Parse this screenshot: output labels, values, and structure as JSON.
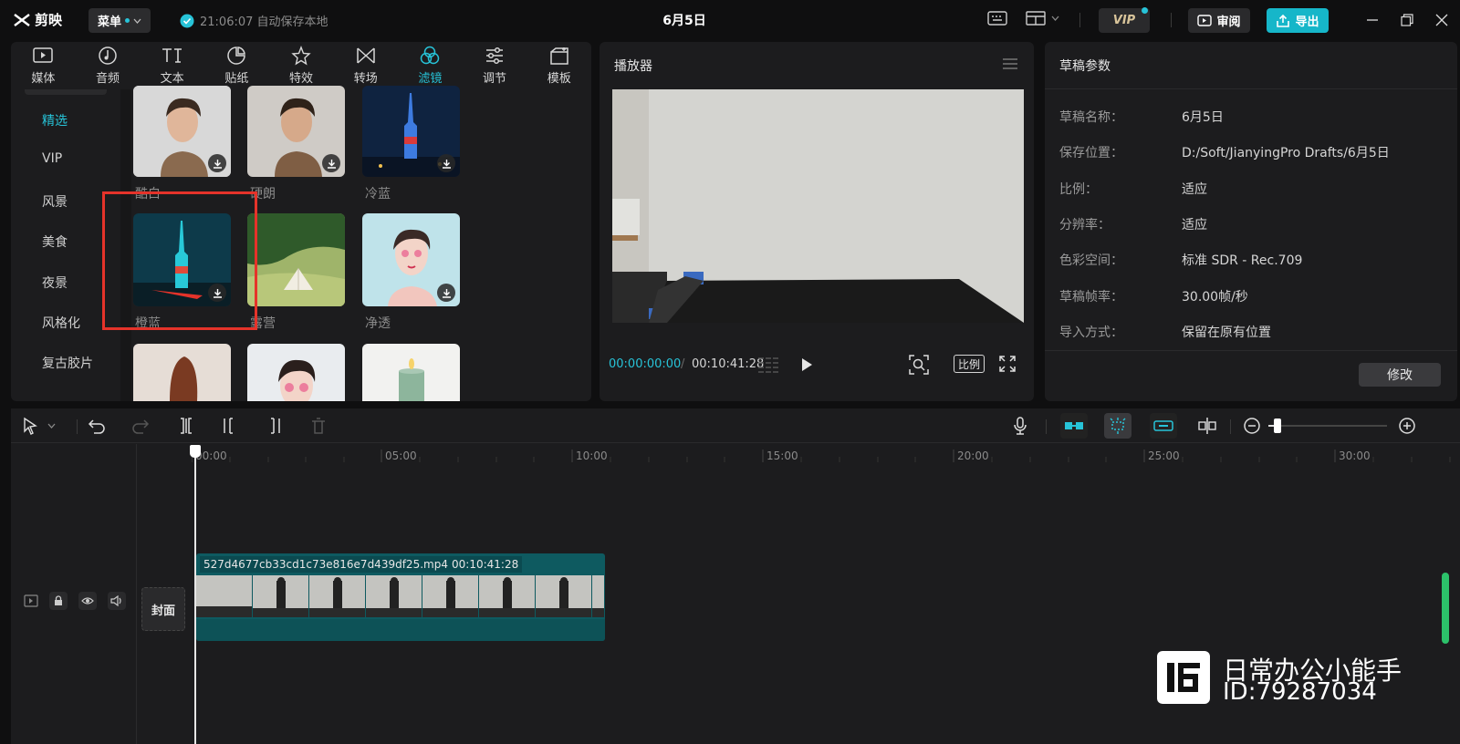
{
  "app": {
    "logo_text": "剪映",
    "menu_label": "菜单",
    "autosave_text": "21:06:07 自动保存本地",
    "doc_title": "6月5日",
    "vip_label": "VIP",
    "review_label": "审阅",
    "export_label": "导出"
  },
  "tabs": [
    {
      "label": "媒体",
      "icon": "media-icon"
    },
    {
      "label": "音频",
      "icon": "audio-icon"
    },
    {
      "label": "文本",
      "icon": "text-icon"
    },
    {
      "label": "贴纸",
      "icon": "sticker-icon"
    },
    {
      "label": "特效",
      "icon": "effects-icon"
    },
    {
      "label": "转场",
      "icon": "transition-icon"
    },
    {
      "label": "滤镜",
      "icon": "filter-icon",
      "active": true
    },
    {
      "label": "调节",
      "icon": "adjust-icon"
    },
    {
      "label": "模板",
      "icon": "template-icon"
    }
  ],
  "categories": [
    "精选",
    "VIP",
    "风景",
    "美食",
    "夜景",
    "风格化",
    "复古胶片"
  ],
  "active_category": "精选",
  "filters": [
    {
      "label": "酷白"
    },
    {
      "label": "硬朗"
    },
    {
      "label": "冷蓝"
    },
    {
      "label": "橙蓝"
    },
    {
      "label": "露营"
    },
    {
      "label": "净透"
    }
  ],
  "player": {
    "title": "播放器",
    "current_time": "00:00:00:00",
    "separator": "/",
    "total_time": "00:10:41:28",
    "ratio_label": "比例"
  },
  "draft": {
    "title": "草稿参数",
    "params": [
      {
        "label": "草稿名称：",
        "value": "6月5日"
      },
      {
        "label": "保存位置：",
        "value": "D:/Soft/JianyingPro Drafts/6月5日"
      },
      {
        "label": "比例：",
        "value": "适应"
      },
      {
        "label": "分辨率：",
        "value": "适应"
      },
      {
        "label": "色彩空间：",
        "value": "标准 SDR - Rec.709"
      },
      {
        "label": "草稿帧率：",
        "value": "30.00帧/秒"
      },
      {
        "label": "导入方式：",
        "value": "保留在原有位置"
      }
    ],
    "modify_label": "修改"
  },
  "timeline": {
    "ruler_labels": [
      "00:00",
      "05:00",
      "10:00",
      "15:00",
      "20:00",
      "25:00",
      "30:00"
    ],
    "cover_label": "封面",
    "clip_name": "527d4677cb33cd1c73e816e7d439df25.mp4",
    "clip_duration": "00:10:41:28"
  },
  "watermark": {
    "name": "日常办公小能手",
    "id": "ID:79287034"
  },
  "colors": {
    "accent": "#27c3d8",
    "export_bg": "#16b6c9",
    "highlight": "#e5332a",
    "clip": "#0e5a60"
  }
}
